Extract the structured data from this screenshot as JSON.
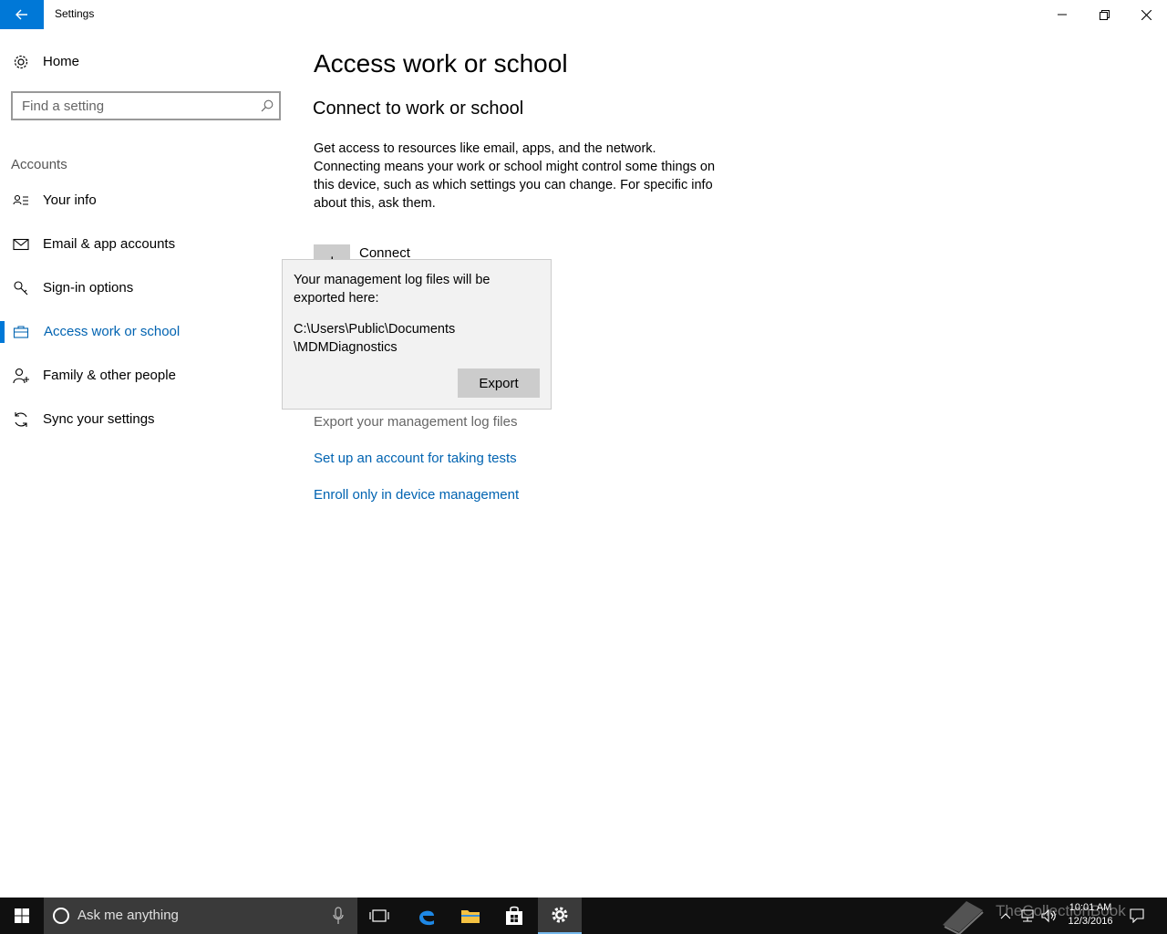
{
  "window": {
    "title": "Settings",
    "back_icon": "arrow-left-icon",
    "controls": [
      "minimize-icon",
      "restore-icon",
      "close-icon"
    ]
  },
  "sidebar": {
    "home_label": "Home",
    "search_placeholder": "Find a setting",
    "section_header": "Accounts",
    "items": [
      {
        "label": "Your info",
        "icon": "person-card-icon"
      },
      {
        "label": "Email & app accounts",
        "icon": "mail-icon"
      },
      {
        "label": "Sign-in options",
        "icon": "key-icon"
      },
      {
        "label": "Access work or school",
        "icon": "briefcase-icon",
        "active": true
      },
      {
        "label": "Family & other people",
        "icon": "person-add-icon"
      },
      {
        "label": "Sync your settings",
        "icon": "sync-icon"
      }
    ]
  },
  "main": {
    "title": "Access work or school",
    "subtitle": "Connect to work or school",
    "description": "Get access to resources like email, apps, and the network. Connecting means your work or school might control some things on this device, such as which settings you can change. For specific info about this, ask them.",
    "connect_label": "Connect",
    "links": [
      {
        "label": "Export your management log files",
        "muted": true
      },
      {
        "label": "Set up an account for taking tests"
      },
      {
        "label": "Enroll only in device management"
      }
    ]
  },
  "flyout": {
    "message": "Your management log files will be exported here:",
    "path_line1": "C:\\Users\\Public\\Documents",
    "path_line2": "\\MDMDiagnostics",
    "button_label": "Export"
  },
  "taskbar": {
    "search_placeholder": "Ask me anything",
    "clock_time": "10:01 AM",
    "clock_date": "12/3/2016",
    "watermark": "TheCollectionBook",
    "accent": "#0078d7"
  }
}
